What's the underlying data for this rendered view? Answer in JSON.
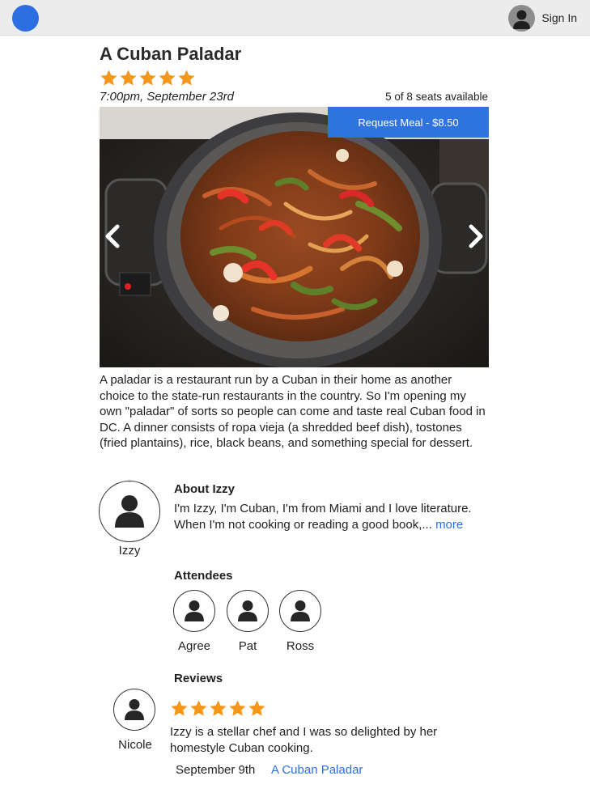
{
  "header": {
    "logo_icon": "logo-circle",
    "signin_label": "Sign In",
    "signin_icon": "user-icon"
  },
  "event": {
    "title": "A Cuban Paladar",
    "rating": 5,
    "rating_max": 5,
    "datetime": "7:00pm, September 23rd",
    "seats": "5 of 8 seats available",
    "request_label": "Request Meal - $8.50",
    "description": "A paladar is a restaurant run by a Cuban in their home as another choice to the state-run restaurants in the country. So I'm opening my own \"paladar\" of sorts so people can come and taste real Cuban food in DC. A dinner consists of ropa vieja (a shredded beef dish), tostones (fried plantains), rice, black beans, and something special for dessert."
  },
  "host": {
    "name": "Izzy",
    "about_heading": "About Izzy",
    "about_text": "I'm Izzy, I'm Cuban, I'm from Miami and I love literature. When I'm not cooking or reading a good book,...",
    "more_label": "more"
  },
  "attendees": {
    "heading": "Attendees",
    "people": [
      {
        "name": "Agree"
      },
      {
        "name": "Pat"
      },
      {
        "name": "Ross"
      }
    ]
  },
  "reviews": {
    "heading": "Reviews",
    "items": [
      {
        "reviewer": "Nicole",
        "rating": 5,
        "text": "Izzy is a stellar chef and I was so delighted by her homestyle Cuban cooking.",
        "date": "September 9th",
        "event_link": "A Cuban Paladar"
      }
    ]
  },
  "colors": {
    "accent": "#2f73df",
    "star": "#f5961d",
    "link": "#2d6fe0"
  }
}
